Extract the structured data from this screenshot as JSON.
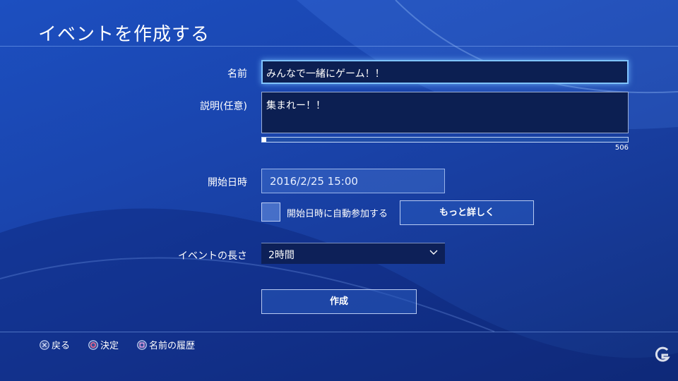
{
  "header": {
    "title": "イベントを作成する"
  },
  "form": {
    "name": {
      "label": "名前",
      "value": "みんなで一緒にゲーム！！"
    },
    "description": {
      "label": "説明(任意)",
      "value": "集まれー！！",
      "remaining_chars": "506",
      "usage_fraction": 0.012
    },
    "start_datetime": {
      "label": "開始日時",
      "value": "2016/2/25   15:00"
    },
    "auto_join": {
      "label": "開始日時に自動参加する",
      "checked": false
    },
    "more_details_button": "もっと詳しく",
    "duration": {
      "label": "イベントの長さ",
      "value": "2時間"
    },
    "create_button": "作成"
  },
  "footer": {
    "hints": [
      {
        "icon": "cross-button-icon",
        "label": "戻る"
      },
      {
        "icon": "circle-button-icon",
        "label": "決定"
      },
      {
        "icon": "square-button-icon",
        "label": "名前の履歴"
      }
    ]
  },
  "colors": {
    "background": "#1a45ae",
    "input_dark": "#0c1f52",
    "focus_glow": "#7fc3ff"
  }
}
